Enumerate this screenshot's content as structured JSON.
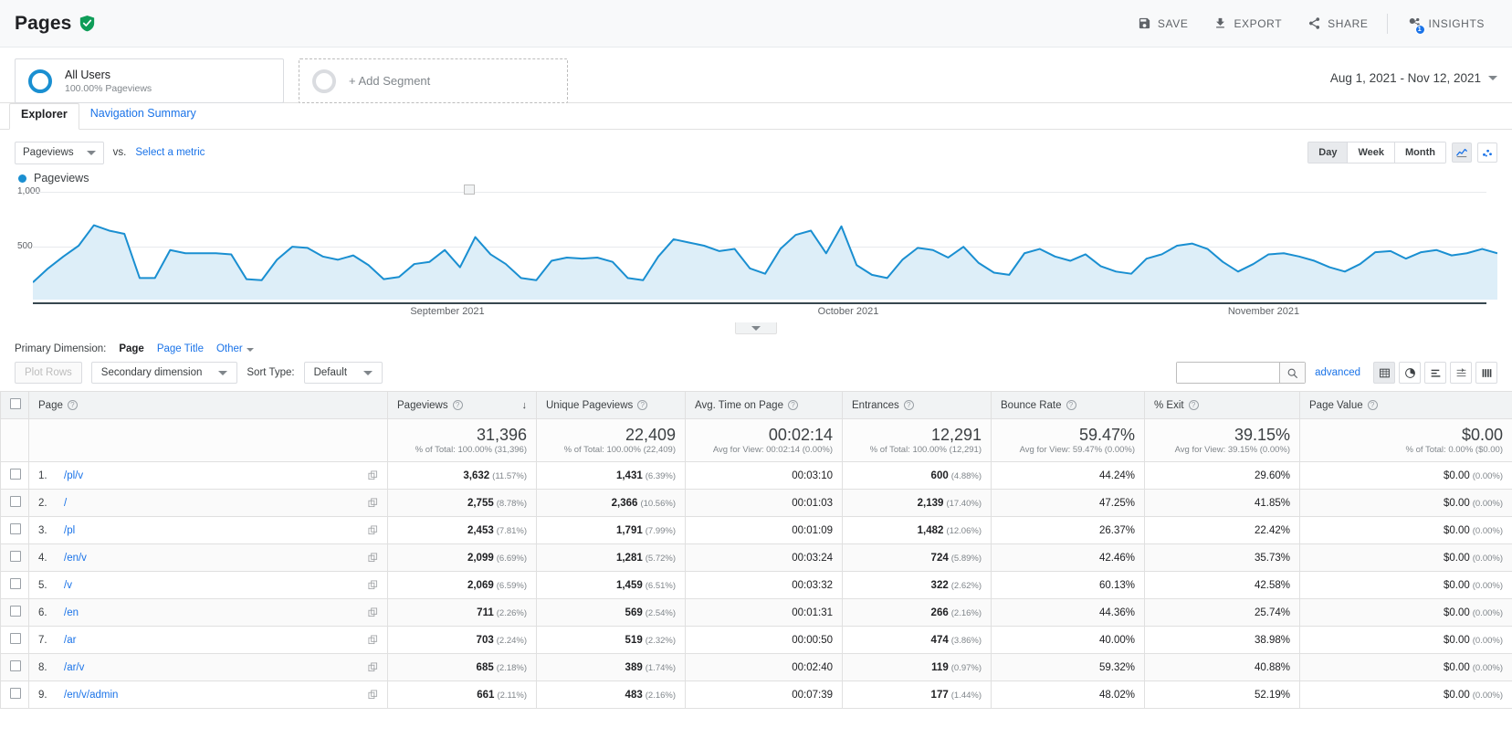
{
  "header": {
    "title": "Pages",
    "verified_icon": "shield-check-icon",
    "actions": [
      {
        "label": "SAVE",
        "icon": "save-icon"
      },
      {
        "label": "EXPORT",
        "icon": "download-icon"
      },
      {
        "label": "SHARE",
        "icon": "share-icon"
      },
      {
        "label": "INSIGHTS",
        "icon": "insights-icon",
        "badge": "1"
      }
    ]
  },
  "segments": {
    "all_users": {
      "name": "All Users",
      "sub": "100.00% Pageviews"
    },
    "add_segment": {
      "label": "+ Add Segment"
    }
  },
  "date_range": {
    "value": "Aug 1, 2021 - Nov 12, 2021"
  },
  "tabs": [
    {
      "label": "Explorer",
      "active": true
    },
    {
      "label": "Navigation Summary",
      "active": false
    }
  ],
  "chart_controls": {
    "metric_select": "Pageviews",
    "vs_label": "vs.",
    "select_metric_link": "Select a metric",
    "granularity": [
      {
        "label": "Day",
        "active": true
      },
      {
        "label": "Week",
        "active": false
      },
      {
        "label": "Month",
        "active": false
      }
    ],
    "chart_type_line": "line-chart-icon",
    "chart_type_scatter": "scatter-chart-icon"
  },
  "chart_data": {
    "type": "area",
    "title": "Pageviews",
    "legend": [
      "Pageviews"
    ],
    "legend_position": "top-left",
    "xlabel": "",
    "ylabel": "",
    "ylim": [
      0,
      1000
    ],
    "yticks": [
      500,
      1000
    ],
    "ytick_labels": [
      "500",
      "1,000"
    ],
    "grid": true,
    "x_axis_labels": [
      "September 2021",
      "October 2021",
      "November 2021"
    ],
    "series_color": "#1a8fd1",
    "fill_color": "#ddeef8",
    "values": [
      160,
      290,
      400,
      500,
      690,
      640,
      610,
      200,
      200,
      460,
      430,
      430,
      430,
      420,
      190,
      180,
      370,
      490,
      480,
      400,
      370,
      410,
      320,
      190,
      210,
      330,
      350,
      460,
      300,
      580,
      420,
      330,
      200,
      180,
      360,
      390,
      380,
      390,
      350,
      200,
      180,
      400,
      560,
      530,
      500,
      450,
      470,
      290,
      240,
      470,
      600,
      640,
      430,
      680,
      320,
      230,
      200,
      370,
      480,
      460,
      390,
      490,
      340,
      250,
      230,
      430,
      470,
      400,
      360,
      420,
      310,
      260,
      240,
      380,
      420,
      500,
      520,
      470,
      350,
      260,
      330,
      420,
      430,
      400,
      360,
      300,
      260,
      330,
      440,
      450,
      380,
      440,
      460,
      410,
      430,
      470,
      430
    ]
  },
  "primary_dimension": {
    "label": "Primary Dimension:",
    "options": [
      {
        "label": "Page",
        "active": true
      },
      {
        "label": "Page Title",
        "active": false
      },
      {
        "label": "Other",
        "active": false,
        "has_caret": true
      }
    ]
  },
  "table_toolbar": {
    "plot_rows": "Plot Rows",
    "secondary_dimension": "Secondary dimension",
    "sort_type_label": "Sort Type:",
    "sort_type_value": "Default",
    "search_placeholder": "",
    "search_value": "",
    "search_icon": "search-icon",
    "advanced": "advanced",
    "view_buttons": [
      {
        "icon": "table-view-icon",
        "active": true
      },
      {
        "icon": "pie-view-icon",
        "active": false
      },
      {
        "icon": "performance-view-icon",
        "active": false
      },
      {
        "icon": "comparison-view-icon",
        "active": false
      },
      {
        "icon": "pivot-view-icon",
        "active": false
      }
    ]
  },
  "table": {
    "columns": [
      {
        "key": "page",
        "label": "Page",
        "help": true,
        "sorted": false
      },
      {
        "key": "pageviews",
        "label": "Pageviews",
        "help": true,
        "sorted": true,
        "sort_dir": "desc"
      },
      {
        "key": "unique_pageviews",
        "label": "Unique Pageviews",
        "help": true
      },
      {
        "key": "avg_time",
        "label": "Avg. Time on Page",
        "help": true
      },
      {
        "key": "entrances",
        "label": "Entrances",
        "help": true
      },
      {
        "key": "bounce_rate",
        "label": "Bounce Rate",
        "help": true
      },
      {
        "key": "exit_pct",
        "label": "% Exit",
        "help": true
      },
      {
        "key": "page_value",
        "label": "Page Value",
        "help": true
      }
    ],
    "summary": {
      "pageviews": {
        "value": "31,396",
        "sub": "% of Total: 100.00% (31,396)"
      },
      "unique_pageviews": {
        "value": "22,409",
        "sub": "% of Total: 100.00% (22,409)"
      },
      "avg_time": {
        "value": "00:02:14",
        "sub": "Avg for View: 00:02:14 (0.00%)"
      },
      "entrances": {
        "value": "12,291",
        "sub": "% of Total: 100.00% (12,291)"
      },
      "bounce_rate": {
        "value": "59.47%",
        "sub": "Avg for View: 59.47% (0.00%)"
      },
      "exit_pct": {
        "value": "39.15%",
        "sub": "Avg for View: 39.15% (0.00%)"
      },
      "page_value": {
        "value": "$0.00",
        "sub": "% of Total: 0.00% ($0.00)"
      }
    },
    "rows": [
      {
        "num": "1.",
        "page": "/pl/v",
        "pageviews": "3,632",
        "pageviews_pct": "(11.57%)",
        "unique_pageviews": "1,431",
        "unique_pageviews_pct": "(6.39%)",
        "avg_time": "00:03:10",
        "entrances": "600",
        "entrances_pct": "(4.88%)",
        "bounce_rate": "44.24%",
        "exit_pct": "29.60%",
        "page_value": "$0.00",
        "page_value_pct": "(0.00%)"
      },
      {
        "num": "2.",
        "page": "/",
        "pageviews": "2,755",
        "pageviews_pct": "(8.78%)",
        "unique_pageviews": "2,366",
        "unique_pageviews_pct": "(10.56%)",
        "avg_time": "00:01:03",
        "entrances": "2,139",
        "entrances_pct": "(17.40%)",
        "bounce_rate": "47.25%",
        "exit_pct": "41.85%",
        "page_value": "$0.00",
        "page_value_pct": "(0.00%)"
      },
      {
        "num": "3.",
        "page": "/pl",
        "pageviews": "2,453",
        "pageviews_pct": "(7.81%)",
        "unique_pageviews": "1,791",
        "unique_pageviews_pct": "(7.99%)",
        "avg_time": "00:01:09",
        "entrances": "1,482",
        "entrances_pct": "(12.06%)",
        "bounce_rate": "26.37%",
        "exit_pct": "22.42%",
        "page_value": "$0.00",
        "page_value_pct": "(0.00%)"
      },
      {
        "num": "4.",
        "page": "/en/v",
        "pageviews": "2,099",
        "pageviews_pct": "(6.69%)",
        "unique_pageviews": "1,281",
        "unique_pageviews_pct": "(5.72%)",
        "avg_time": "00:03:24",
        "entrances": "724",
        "entrances_pct": "(5.89%)",
        "bounce_rate": "42.46%",
        "exit_pct": "35.73%",
        "page_value": "$0.00",
        "page_value_pct": "(0.00%)"
      },
      {
        "num": "5.",
        "page": "/v",
        "pageviews": "2,069",
        "pageviews_pct": "(6.59%)",
        "unique_pageviews": "1,459",
        "unique_pageviews_pct": "(6.51%)",
        "avg_time": "00:03:32",
        "entrances": "322",
        "entrances_pct": "(2.62%)",
        "bounce_rate": "60.13%",
        "exit_pct": "42.58%",
        "page_value": "$0.00",
        "page_value_pct": "(0.00%)"
      },
      {
        "num": "6.",
        "page": "/en",
        "pageviews": "711",
        "pageviews_pct": "(2.26%)",
        "unique_pageviews": "569",
        "unique_pageviews_pct": "(2.54%)",
        "avg_time": "00:01:31",
        "entrances": "266",
        "entrances_pct": "(2.16%)",
        "bounce_rate": "44.36%",
        "exit_pct": "25.74%",
        "page_value": "$0.00",
        "page_value_pct": "(0.00%)"
      },
      {
        "num": "7.",
        "page": "/ar",
        "pageviews": "703",
        "pageviews_pct": "(2.24%)",
        "unique_pageviews": "519",
        "unique_pageviews_pct": "(2.32%)",
        "avg_time": "00:00:50",
        "entrances": "474",
        "entrances_pct": "(3.86%)",
        "bounce_rate": "40.00%",
        "exit_pct": "38.98%",
        "page_value": "$0.00",
        "page_value_pct": "(0.00%)"
      },
      {
        "num": "8.",
        "page": "/ar/v",
        "pageviews": "685",
        "pageviews_pct": "(2.18%)",
        "unique_pageviews": "389",
        "unique_pageviews_pct": "(1.74%)",
        "avg_time": "00:02:40",
        "entrances": "119",
        "entrances_pct": "(0.97%)",
        "bounce_rate": "59.32%",
        "exit_pct": "40.88%",
        "page_value": "$0.00",
        "page_value_pct": "(0.00%)"
      },
      {
        "num": "9.",
        "page": "/en/v/admin",
        "pageviews": "661",
        "pageviews_pct": "(2.11%)",
        "unique_pageviews": "483",
        "unique_pageviews_pct": "(2.16%)",
        "avg_time": "00:07:39",
        "entrances": "177",
        "entrances_pct": "(1.44%)",
        "bounce_rate": "48.02%",
        "exit_pct": "52.19%",
        "page_value": "$0.00",
        "page_value_pct": "(0.00%)"
      }
    ]
  }
}
